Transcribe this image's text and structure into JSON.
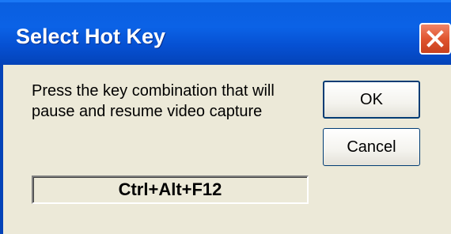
{
  "window": {
    "title": "Select Hot Key",
    "close_icon": "close-icon"
  },
  "prompt": {
    "line1": "Press the key combination that will",
    "line2": "pause and resume video capture"
  },
  "buttons": {
    "ok_label": "OK",
    "cancel_label": "Cancel"
  },
  "hotkey": {
    "value": "Ctrl+Alt+F12"
  },
  "colors": {
    "titlebar": "#0a5fe0",
    "close_button": "#e0552f",
    "dialog_face": "#ece9d8"
  }
}
